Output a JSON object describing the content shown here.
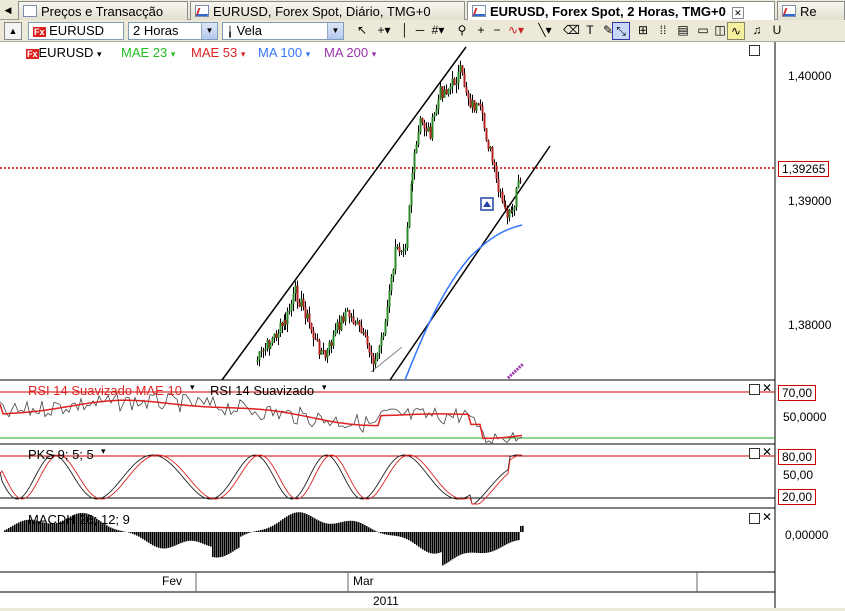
{
  "tabs": [
    {
      "label": "Preços e Transacção",
      "icon": "arrows-icon",
      "active": false
    },
    {
      "label": "EURUSD, Forex Spot, Diário, TMG+0",
      "icon": "chart-icon",
      "active": false
    },
    {
      "label": "EURUSD, Forex Spot, 2 Horas, TMG+0",
      "icon": "chart-icon",
      "active": true
    },
    {
      "label": "Re",
      "icon": "chart-icon",
      "active": false
    }
  ],
  "toolbar": {
    "symbol": "EURUSD",
    "symbol_badge": "Fx",
    "timeframe": "2 Horas",
    "chart_type": "Vela"
  },
  "legend": {
    "symbol": "EURUSD",
    "symbol_badge": "Fx",
    "items": [
      {
        "label": "MAE 23",
        "color": "#22bb22"
      },
      {
        "label": "MAE 53",
        "color": "#dd2222"
      },
      {
        "label": "MA 100",
        "color": "#3377ff"
      },
      {
        "label": "MA 200",
        "color": "#9933aa"
      }
    ]
  },
  "price_axis": {
    "ticks": [
      "1,40000",
      "1,39000",
      "1,38000"
    ],
    "current_price": "1,39265",
    "colors": {
      "current": "#cc0000"
    }
  },
  "rsi_pane": {
    "label_main": "RSI 14 Suavizado MAE 10",
    "label_sub": "RSI 14 Suavizado",
    "level_high": "70,00",
    "level_mid": "50,0000"
  },
  "stoch_pane": {
    "label": "PKS 9; 5; 5",
    "level_high": "80,00",
    "level_mid": "50,00",
    "level_low": "20,00"
  },
  "macd_pane": {
    "label": "MACDH 26; 12; 9",
    "level_zero": "0,00000"
  },
  "time_axis": {
    "labels": [
      "Fev",
      "Mar"
    ],
    "year": "2011"
  }
}
